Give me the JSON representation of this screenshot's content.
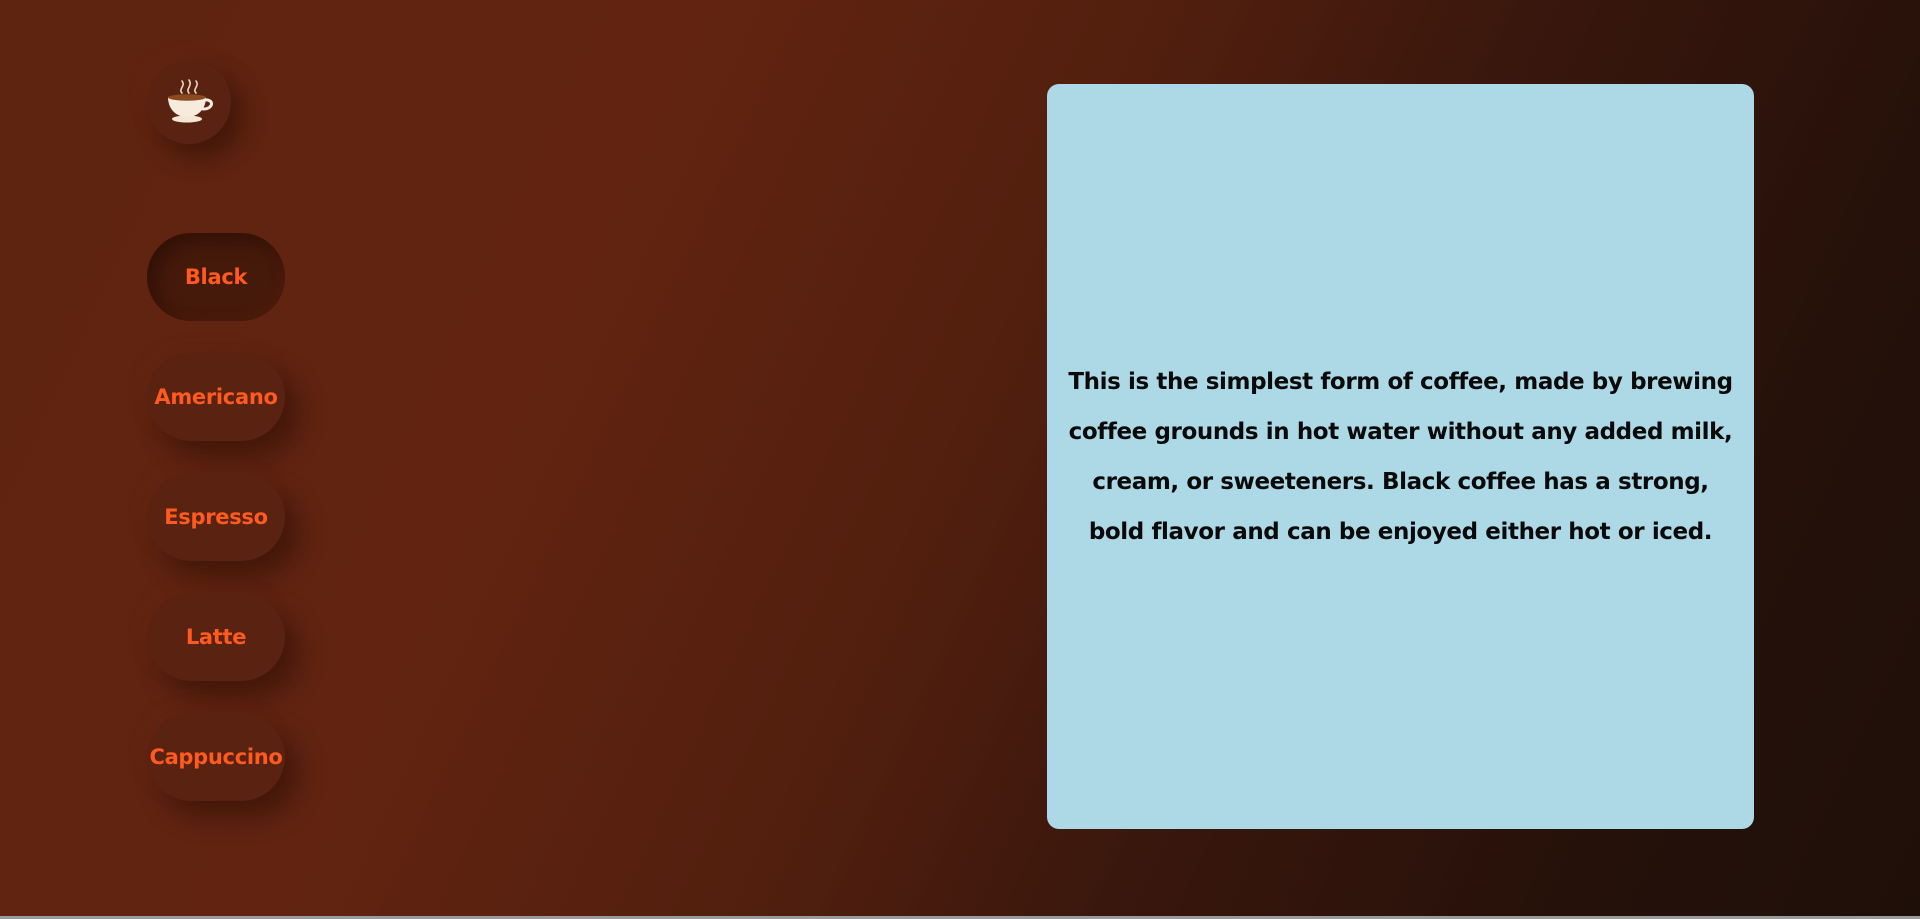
{
  "logo": {
    "icon": "coffee-cup-icon"
  },
  "menu": {
    "items": [
      {
        "label": "Black",
        "active": true
      },
      {
        "label": "Americano",
        "active": false
      },
      {
        "label": "Espresso",
        "active": false
      },
      {
        "label": "Latte",
        "active": false
      },
      {
        "label": "Cappuccino",
        "active": false
      }
    ]
  },
  "description": {
    "text": "This is the simplest form of coffee, made by brewing coffee grounds in hot water without any added milk, cream, or sweeteners. Black coffee has a strong, bold flavor and can be enjoyed either hot or iced."
  },
  "colors": {
    "background": "#5e2410",
    "button_text": "#ff5a1f",
    "card_background": "#add8e6",
    "card_text": "#0a0a0a"
  }
}
